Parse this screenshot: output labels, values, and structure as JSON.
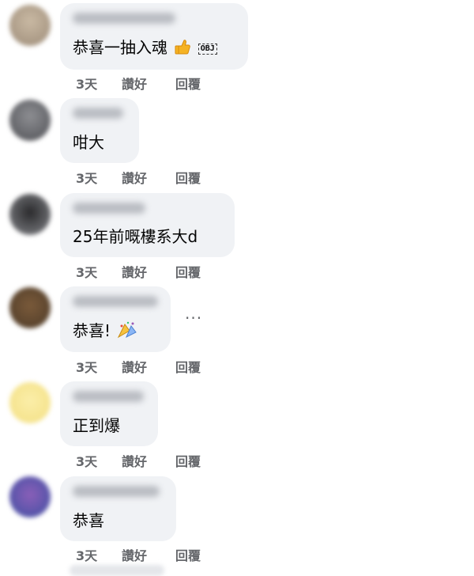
{
  "comments": [
    {
      "text": "恭喜一抽入魂",
      "emoji": "thumbs-up-icon",
      "badge": "OBJ",
      "time": "3天",
      "like": "讚好",
      "reply": "回覆"
    },
    {
      "text": "咁大",
      "time": "3天",
      "like": "讚好",
      "reply": "回覆"
    },
    {
      "text": "25年前嘅樓系大d",
      "time": "3天",
      "like": "讚好",
      "reply": "回覆"
    },
    {
      "text": "恭喜!",
      "emoji": "party-icon",
      "time": "3天",
      "like": "讚好",
      "reply": "回覆",
      "more": "···"
    },
    {
      "text": "正到爆",
      "time": "3天",
      "like": "讚好",
      "reply": "回覆"
    },
    {
      "text": "恭喜",
      "time": "3天",
      "like": "讚好",
      "reply": "回覆"
    }
  ],
  "colors": {
    "bubble": "#f0f2f5",
    "meta": "#65676b"
  }
}
